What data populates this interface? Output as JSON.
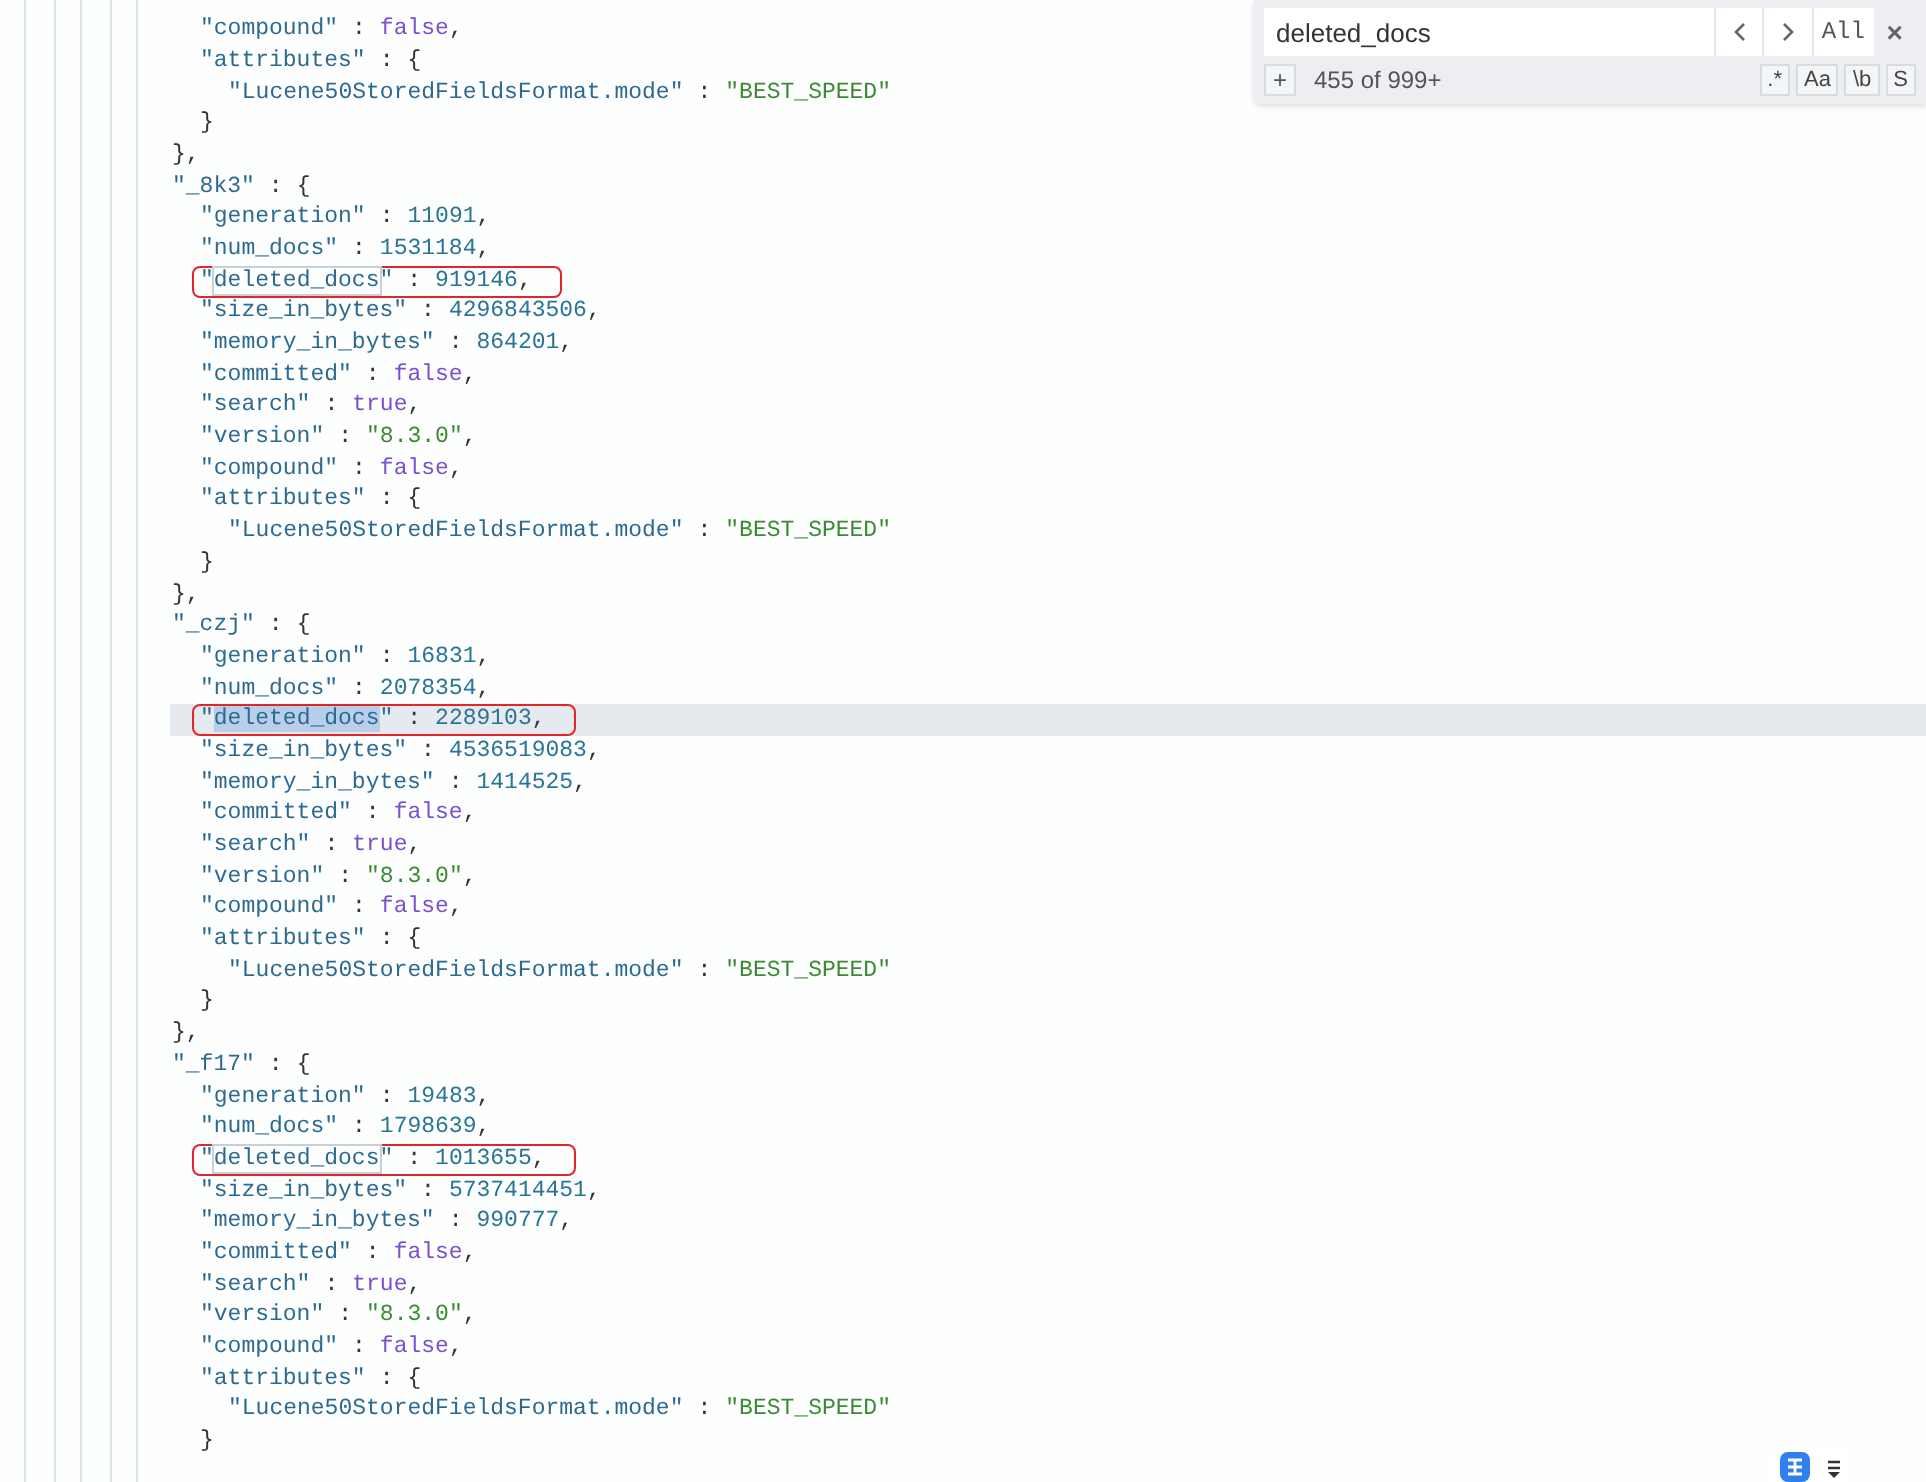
{
  "editor": {
    "lines": [
      {
        "children": [
          {
            "key": "\"compound\"",
            "sep": ":",
            "value": "false",
            "kind": "bool",
            "tail": ","
          },
          {
            "key": "\"attributes\"",
            "sep": ":",
            "value": "{",
            "kind": "punct",
            "children": [
              {
                "key": "\"Lucene50StoredFieldsFormat.mode\"",
                "sep": ":",
                "value": "\"BEST_SPEED\"",
                "kind": "string"
              }
            ]
          },
          {
            "text": "}"
          }
        ]
      },
      {
        "text": "},"
      },
      {
        "key": "\"_8k3\"",
        "sep": ":",
        "value": "{",
        "kind": "punct",
        "children": [
          {
            "key": "\"generation\"",
            "sep": ":",
            "value": "11091",
            "kind": "number",
            "tail": ","
          },
          {
            "key": "\"num_docs\"",
            "sep": ":",
            "value": "1531184",
            "kind": "number",
            "tail": ","
          },
          {
            "key_parts": [
              "\"",
              "deleted_docs",
              "\""
            ],
            "match": true,
            "current": false,
            "boxed": true,
            "sep": ":",
            "value": "919146",
            "kind": "number",
            "tail": ","
          },
          {
            "key": "\"size_in_bytes\"",
            "sep": ":",
            "value": "4296843506",
            "kind": "number",
            "tail": ","
          },
          {
            "key": "\"memory_in_bytes\"",
            "sep": ":",
            "value": "864201",
            "kind": "number",
            "tail": ","
          },
          {
            "key": "\"committed\"",
            "sep": ":",
            "value": "false",
            "kind": "bool",
            "tail": ","
          },
          {
            "key": "\"search\"",
            "sep": ":",
            "value": "true",
            "kind": "bool",
            "tail": ","
          },
          {
            "key": "\"version\"",
            "sep": ":",
            "value": "\"8.3.0\"",
            "kind": "string",
            "tail": ","
          },
          {
            "key": "\"compound\"",
            "sep": ":",
            "value": "false",
            "kind": "bool",
            "tail": ","
          },
          {
            "key": "\"attributes\"",
            "sep": ":",
            "value": "{",
            "kind": "punct",
            "children": [
              {
                "key": "\"Lucene50StoredFieldsFormat.mode\"",
                "sep": ":",
                "value": "\"BEST_SPEED\"",
                "kind": "string"
              }
            ]
          },
          {
            "text": "}"
          }
        ]
      },
      {
        "text": "},"
      },
      {
        "key": "\"_czj\"",
        "sep": ":",
        "value": "{",
        "kind": "punct",
        "children": [
          {
            "key": "\"generation\"",
            "sep": ":",
            "value": "16831",
            "kind": "number",
            "tail": ","
          },
          {
            "key": "\"num_docs\"",
            "sep": ":",
            "value": "2078354",
            "kind": "number",
            "tail": ","
          },
          {
            "key_parts": [
              "\"",
              "deleted_docs",
              "\""
            ],
            "match": true,
            "current": true,
            "boxed": true,
            "sep": ":",
            "value": "2289103",
            "kind": "number",
            "tail": ","
          },
          {
            "key": "\"size_in_bytes\"",
            "sep": ":",
            "value": "4536519083",
            "kind": "number",
            "tail": ","
          },
          {
            "key": "\"memory_in_bytes\"",
            "sep": ":",
            "value": "1414525",
            "kind": "number",
            "tail": ","
          },
          {
            "key": "\"committed\"",
            "sep": ":",
            "value": "false",
            "kind": "bool",
            "tail": ","
          },
          {
            "key": "\"search\"",
            "sep": ":",
            "value": "true",
            "kind": "bool",
            "tail": ","
          },
          {
            "key": "\"version\"",
            "sep": ":",
            "value": "\"8.3.0\"",
            "kind": "string",
            "tail": ","
          },
          {
            "key": "\"compound\"",
            "sep": ":",
            "value": "false",
            "kind": "bool",
            "tail": ","
          },
          {
            "key": "\"attributes\"",
            "sep": ":",
            "value": "{",
            "kind": "punct",
            "children": [
              {
                "key": "\"Lucene50StoredFieldsFormat.mode\"",
                "sep": ":",
                "value": "\"BEST_SPEED\"",
                "kind": "string"
              }
            ]
          },
          {
            "text": "}"
          }
        ]
      },
      {
        "text": "},"
      },
      {
        "key": "\"_f17\"",
        "sep": ":",
        "value": "{",
        "kind": "punct",
        "children": [
          {
            "key": "\"generation\"",
            "sep": ":",
            "value": "19483",
            "kind": "number",
            "tail": ","
          },
          {
            "key": "\"num_docs\"",
            "sep": ":",
            "value": "1798639",
            "kind": "number",
            "tail": ","
          },
          {
            "key_parts": [
              "\"",
              "deleted_docs",
              "\""
            ],
            "match": true,
            "current": false,
            "boxed": true,
            "sep": ":",
            "value": "1013655",
            "kind": "number",
            "tail": ","
          },
          {
            "key": "\"size_in_bytes\"",
            "sep": ":",
            "value": "5737414451",
            "kind": "number",
            "tail": ","
          },
          {
            "key": "\"memory_in_bytes\"",
            "sep": ":",
            "value": "990777",
            "kind": "number",
            "tail": ","
          },
          {
            "key": "\"committed\"",
            "sep": ":",
            "value": "false",
            "kind": "bool",
            "tail": ","
          },
          {
            "key": "\"search\"",
            "sep": ":",
            "value": "true",
            "kind": "bool",
            "tail": ","
          },
          {
            "key": "\"version\"",
            "sep": ":",
            "value": "\"8.3.0\"",
            "kind": "string",
            "tail": ","
          },
          {
            "key": "\"compound\"",
            "sep": ":",
            "value": "false",
            "kind": "bool",
            "tail": ","
          },
          {
            "key": "\"attributes\"",
            "sep": ":",
            "value": "{",
            "kind": "punct",
            "children": [
              {
                "key": "\"Lucene50StoredFieldsFormat.mode\"",
                "sep": ":",
                "value": "\"BEST_SPEED\"",
                "kind": "string"
              }
            ]
          },
          {
            "text": "}"
          }
        ]
      }
    ]
  },
  "find": {
    "value": "deleted_docs",
    "all_label": "All",
    "close": "×",
    "expand": "+",
    "count": "455 of 999+",
    "toggles": [
      {
        "label": ".*"
      },
      {
        "label": "Aa"
      },
      {
        "label": "\\b"
      },
      {
        "label": "S"
      }
    ]
  }
}
